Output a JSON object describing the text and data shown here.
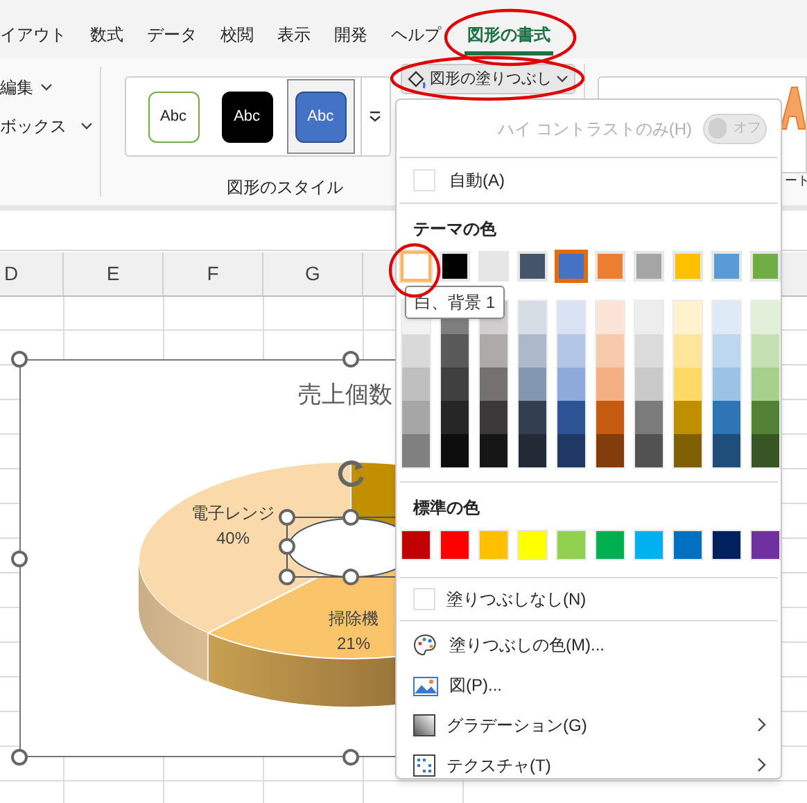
{
  "ribbon_tabs": [
    {
      "label": "イアウト",
      "selected": false
    },
    {
      "label": "数式",
      "selected": false
    },
    {
      "label": "データ",
      "selected": false
    },
    {
      "label": "校閲",
      "selected": false
    },
    {
      "label": "表示",
      "selected": false
    },
    {
      "label": "開発",
      "selected": false
    },
    {
      "label": "ヘルプ",
      "selected": false
    },
    {
      "label": "図形の書式",
      "selected": true
    }
  ],
  "ribbon": {
    "edit_label": "編集",
    "textbox_label": "ボックス",
    "shape_styles": [
      {
        "label": "Abc",
        "kind": "outline",
        "selected": false
      },
      {
        "label": "Abc",
        "kind": "dark",
        "selected": false
      },
      {
        "label": "Abc",
        "kind": "accent",
        "selected": true
      }
    ],
    "group_label": "図形のスタイル",
    "fill_button": "図形の塗りつぶし",
    "cut_label": "ート"
  },
  "columns": [
    "D",
    "E",
    "F",
    "G"
  ],
  "chart": {
    "title": "売上個数",
    "slices": [
      {
        "label": "電子レンジ",
        "percent": "40%"
      },
      {
        "label": "掃除機",
        "percent": "21%"
      }
    ]
  },
  "fill_menu": {
    "high_contrast": {
      "label": "ハイ コントラストのみ(H)",
      "toggle": "オフ",
      "on": false,
      "disabled": true
    },
    "automatic": "自動(A)",
    "theme_heading": "テーマの色",
    "theme_colors": [
      {
        "color": "#ffffff",
        "selected": false,
        "hovered": true
      },
      {
        "color": "#000000",
        "selected": false,
        "hovered": false
      },
      {
        "color": "#e7e6e6",
        "selected": false,
        "hovered": false
      },
      {
        "color": "#44546a",
        "selected": false,
        "hovered": false
      },
      {
        "color": "#4472c4",
        "selected": true,
        "hovered": false
      },
      {
        "color": "#ed7d31",
        "selected": false,
        "hovered": false
      },
      {
        "color": "#a5a5a5",
        "selected": false,
        "hovered": false
      },
      {
        "color": "#ffc000",
        "selected": false,
        "hovered": false
      },
      {
        "color": "#5b9bd5",
        "selected": false,
        "hovered": false
      },
      {
        "color": "#70ad47",
        "selected": false,
        "hovered": false
      }
    ],
    "tint_columns": [
      {
        "shades": [
          {
            "color": "#f2f2f2"
          },
          {
            "color": "#d9d9d9"
          },
          {
            "color": "#bfbfbf"
          },
          {
            "color": "#a6a6a6"
          },
          {
            "color": "#808080"
          }
        ]
      },
      {
        "shades": [
          {
            "color": "#7f7f7f"
          },
          {
            "color": "#595959"
          },
          {
            "color": "#404040"
          },
          {
            "color": "#262626"
          },
          {
            "color": "#0d0d0d"
          }
        ]
      },
      {
        "shades": [
          {
            "color": "#d0cece"
          },
          {
            "color": "#aeaaaa"
          },
          {
            "color": "#757171"
          },
          {
            "color": "#3a3838"
          },
          {
            "color": "#171616"
          }
        ]
      },
      {
        "shades": [
          {
            "color": "#d6dce4"
          },
          {
            "color": "#adb9ca"
          },
          {
            "color": "#8497b0"
          },
          {
            "color": "#333f4f"
          },
          {
            "color": "#222a35"
          }
        ]
      },
      {
        "shades": [
          {
            "color": "#d9e2f3"
          },
          {
            "color": "#b4c6e7"
          },
          {
            "color": "#8eaadb"
          },
          {
            "color": "#2f5496"
          },
          {
            "color": "#1f3864"
          }
        ]
      },
      {
        "shades": [
          {
            "color": "#fbe4d5"
          },
          {
            "color": "#f7caac"
          },
          {
            "color": "#f4b083"
          },
          {
            "color": "#c55a11"
          },
          {
            "color": "#833c0b"
          }
        ]
      },
      {
        "shades": [
          {
            "color": "#ededed"
          },
          {
            "color": "#dbdbdb"
          },
          {
            "color": "#c9c9c9"
          },
          {
            "color": "#7b7b7b"
          },
          {
            "color": "#525252"
          }
        ]
      },
      {
        "shades": [
          {
            "color": "#fff2cc"
          },
          {
            "color": "#ffe599"
          },
          {
            "color": "#ffd966"
          },
          {
            "color": "#bf8f00"
          },
          {
            "color": "#7f6000"
          }
        ]
      },
      {
        "shades": [
          {
            "color": "#deebf6"
          },
          {
            "color": "#bdd7ee"
          },
          {
            "color": "#9cc3e5"
          },
          {
            "color": "#2e75b5"
          },
          {
            "color": "#1e4e79"
          }
        ]
      },
      {
        "shades": [
          {
            "color": "#e2efd9"
          },
          {
            "color": "#c5e0b3"
          },
          {
            "color": "#a8d08d"
          },
          {
            "color": "#538135"
          },
          {
            "color": "#375623"
          }
        ]
      }
    ],
    "tooltip": "白、背景 1",
    "standard_heading": "標準の色",
    "standard_colors": [
      {
        "color": "#c00000"
      },
      {
        "color": "#ff0000"
      },
      {
        "color": "#ffc000"
      },
      {
        "color": "#ffff00"
      },
      {
        "color": "#92d050"
      },
      {
        "color": "#00b050"
      },
      {
        "color": "#00b0f0"
      },
      {
        "color": "#0070c0"
      },
      {
        "color": "#002060"
      },
      {
        "color": "#7030a0"
      }
    ],
    "items": [
      {
        "kind": "none",
        "label": "塗りつぶしなし(N)",
        "submenu": false
      },
      {
        "kind": "palette",
        "label": "塗りつぶしの色(M)...",
        "submenu": false
      },
      {
        "kind": "picture",
        "label": "図(P)...",
        "submenu": false
      },
      {
        "kind": "gradient",
        "label": "グラデーション(G)",
        "submenu": true
      },
      {
        "kind": "texture",
        "label": "テクスチャ(T)",
        "submenu": true
      }
    ]
  }
}
